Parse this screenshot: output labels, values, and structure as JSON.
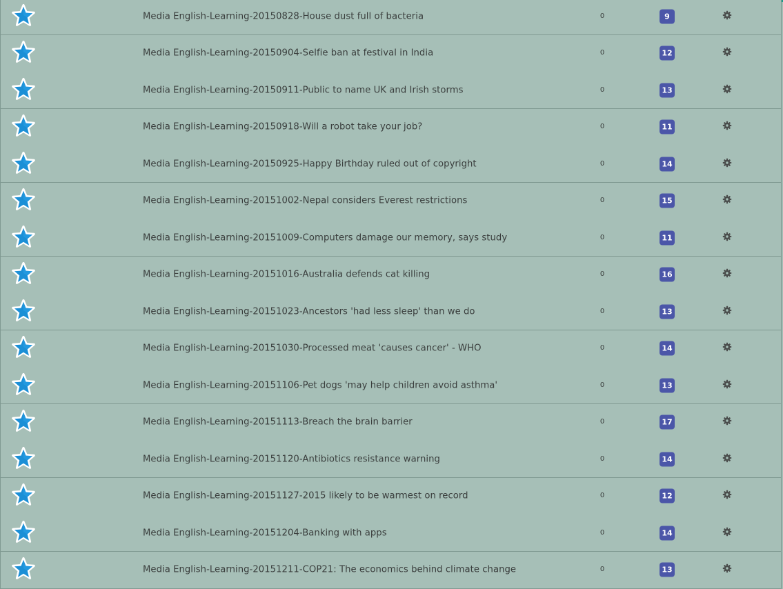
{
  "colors": {
    "accent_top": "#1a9b8c",
    "row_bg": "#a6bfb7",
    "badge_bg": "#4b56a8",
    "star_fill": "#1b8fd6",
    "text": "#3a3e3d"
  },
  "icons": {
    "favorite": "star-icon",
    "settings": "gear-icon"
  },
  "rows": [
    {
      "title": "Media English-Learning-20150828-House dust full of bacteria",
      "count": "0",
      "badge": "9"
    },
    {
      "title": "Media English-Learning-20150904-Selfie ban at festival in India",
      "count": "0",
      "badge": "12"
    },
    {
      "title": "Media English-Learning-20150911-Public to name UK and Irish storms",
      "count": "0",
      "badge": "13"
    },
    {
      "title": "Media English-Learning-20150918-Will a robot take your job?",
      "count": "0",
      "badge": "11"
    },
    {
      "title": "Media English-Learning-20150925-Happy Birthday ruled out of copyright",
      "count": "0",
      "badge": "14"
    },
    {
      "title": "Media English-Learning-20151002-Nepal considers Everest restrictions",
      "count": "0",
      "badge": "15"
    },
    {
      "title": "Media English-Learning-20151009-Computers damage our memory, says study",
      "count": "0",
      "badge": "11"
    },
    {
      "title": "Media English-Learning-20151016-Australia defends cat killing",
      "count": "0",
      "badge": "16"
    },
    {
      "title": "Media English-Learning-20151023-Ancestors 'had less sleep' than we do",
      "count": "0",
      "badge": "13"
    },
    {
      "title": "Media English-Learning-20151030-Processed meat 'causes cancer' - WHO",
      "count": "0",
      "badge": "14"
    },
    {
      "title": "Media English-Learning-20151106-Pet dogs 'may help children avoid asthma'",
      "count": "0",
      "badge": "13"
    },
    {
      "title": "Media English-Learning-20151113-Breach the brain barrier",
      "count": "0",
      "badge": "17"
    },
    {
      "title": "Media English-Learning-20151120-Antibiotics resistance warning",
      "count": "0",
      "badge": "14"
    },
    {
      "title": "Media English-Learning-20151127-2015 likely to be warmest on record",
      "count": "0",
      "badge": "12"
    },
    {
      "title": "Media English-Learning-20151204-Banking with apps",
      "count": "0",
      "badge": "14"
    },
    {
      "title": "Media English-Learning-20151211-COP21: The economics behind climate change",
      "count": "0",
      "badge": "13"
    }
  ]
}
